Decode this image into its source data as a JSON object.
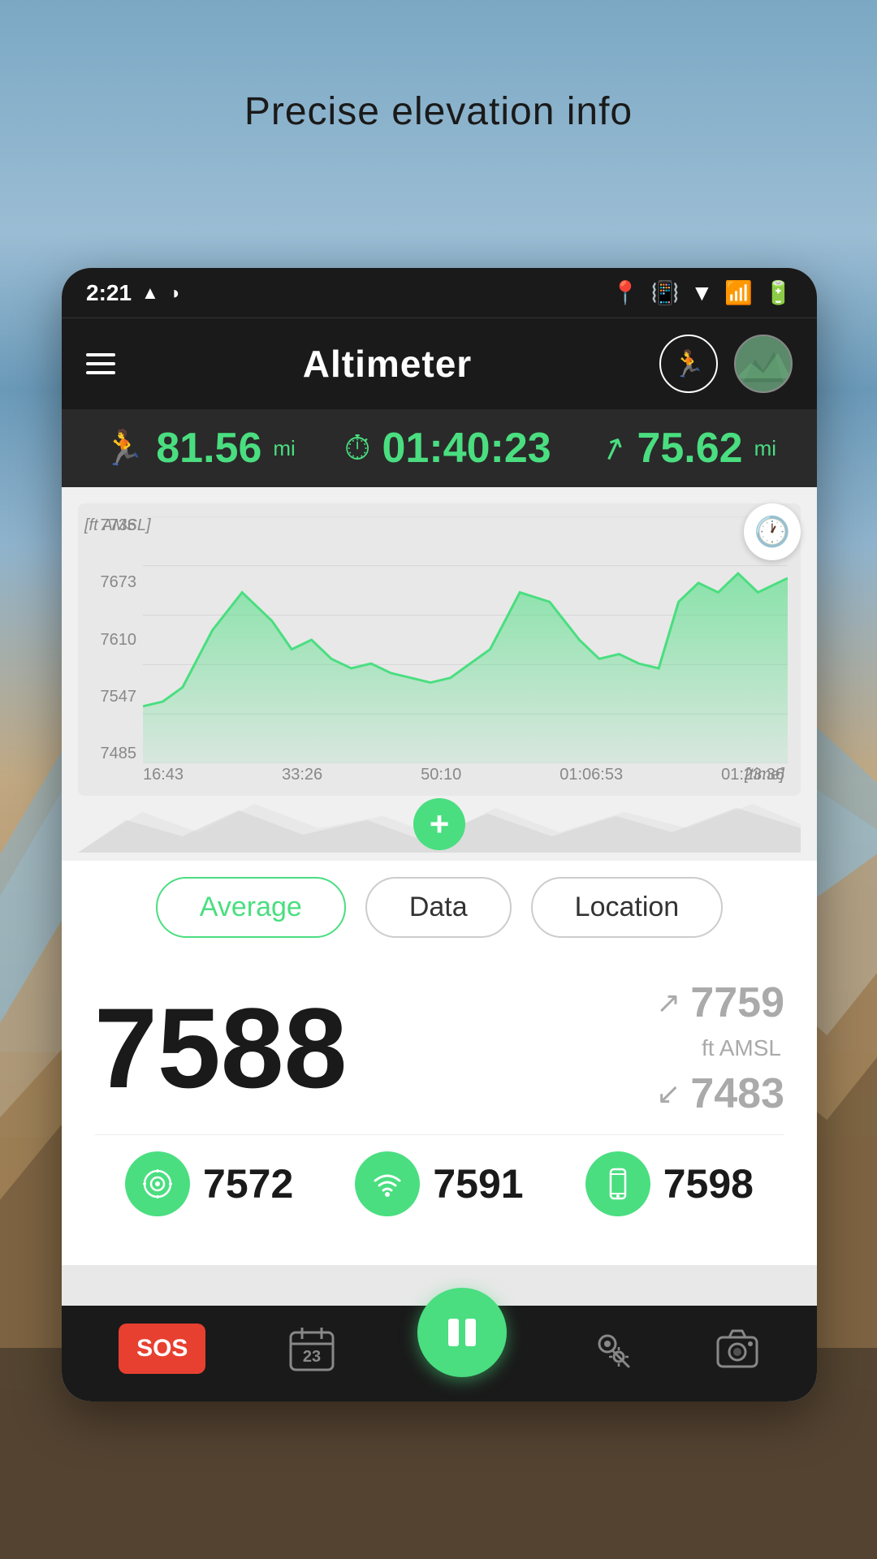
{
  "background": {
    "description": "Mountain landscape with sky"
  },
  "top_text": "Precise elevation info",
  "status_bar": {
    "time": "2:21",
    "icons_left": [
      "signal-triangle",
      "half-circle"
    ],
    "icons_right": [
      "location-pin",
      "vibrate",
      "wifi",
      "signal-bars",
      "battery"
    ]
  },
  "app_bar": {
    "title": "Altimeter",
    "menu_label": "Menu",
    "runner_icon": "🏃",
    "avatar_placeholder": "mountain"
  },
  "metrics_bar": {
    "distance": {
      "value": "81.56",
      "unit": "mi"
    },
    "timer": {
      "value": "01:40:23"
    },
    "speed": {
      "value": "75.62",
      "unit": "mi"
    }
  },
  "chart": {
    "y_label": "[ft AMSL]",
    "x_label": "[time]",
    "y_axis": [
      "7736",
      "7673",
      "7610",
      "7547",
      "7485"
    ],
    "x_axis": [
      "16:43",
      "33:26",
      "50:10",
      "01:06:53",
      "01:23:36"
    ],
    "clock_btn": "⏱"
  },
  "tabs": [
    {
      "id": "average",
      "label": "Average",
      "active": true
    },
    {
      "id": "data",
      "label": "Data",
      "active": false
    },
    {
      "id": "location",
      "label": "Location",
      "active": false
    }
  ],
  "elevation_data": {
    "main_value": "7588",
    "unit": "ft AMSL",
    "max_value": "7759",
    "min_value": "7483",
    "max_arrow": "↗",
    "min_arrow": "↙"
  },
  "sensors": [
    {
      "id": "barometer",
      "icon": "◎",
      "value": "7572"
    },
    {
      "id": "wifi",
      "icon": "wifi",
      "value": "7591"
    },
    {
      "id": "phone",
      "icon": "📱",
      "value": "7598"
    }
  ],
  "bottom_nav": {
    "sos_label": "SOS",
    "calendar_day": "23",
    "play_pause_icon": "⏸",
    "location_icon": "📍",
    "camera_icon": "📷"
  }
}
